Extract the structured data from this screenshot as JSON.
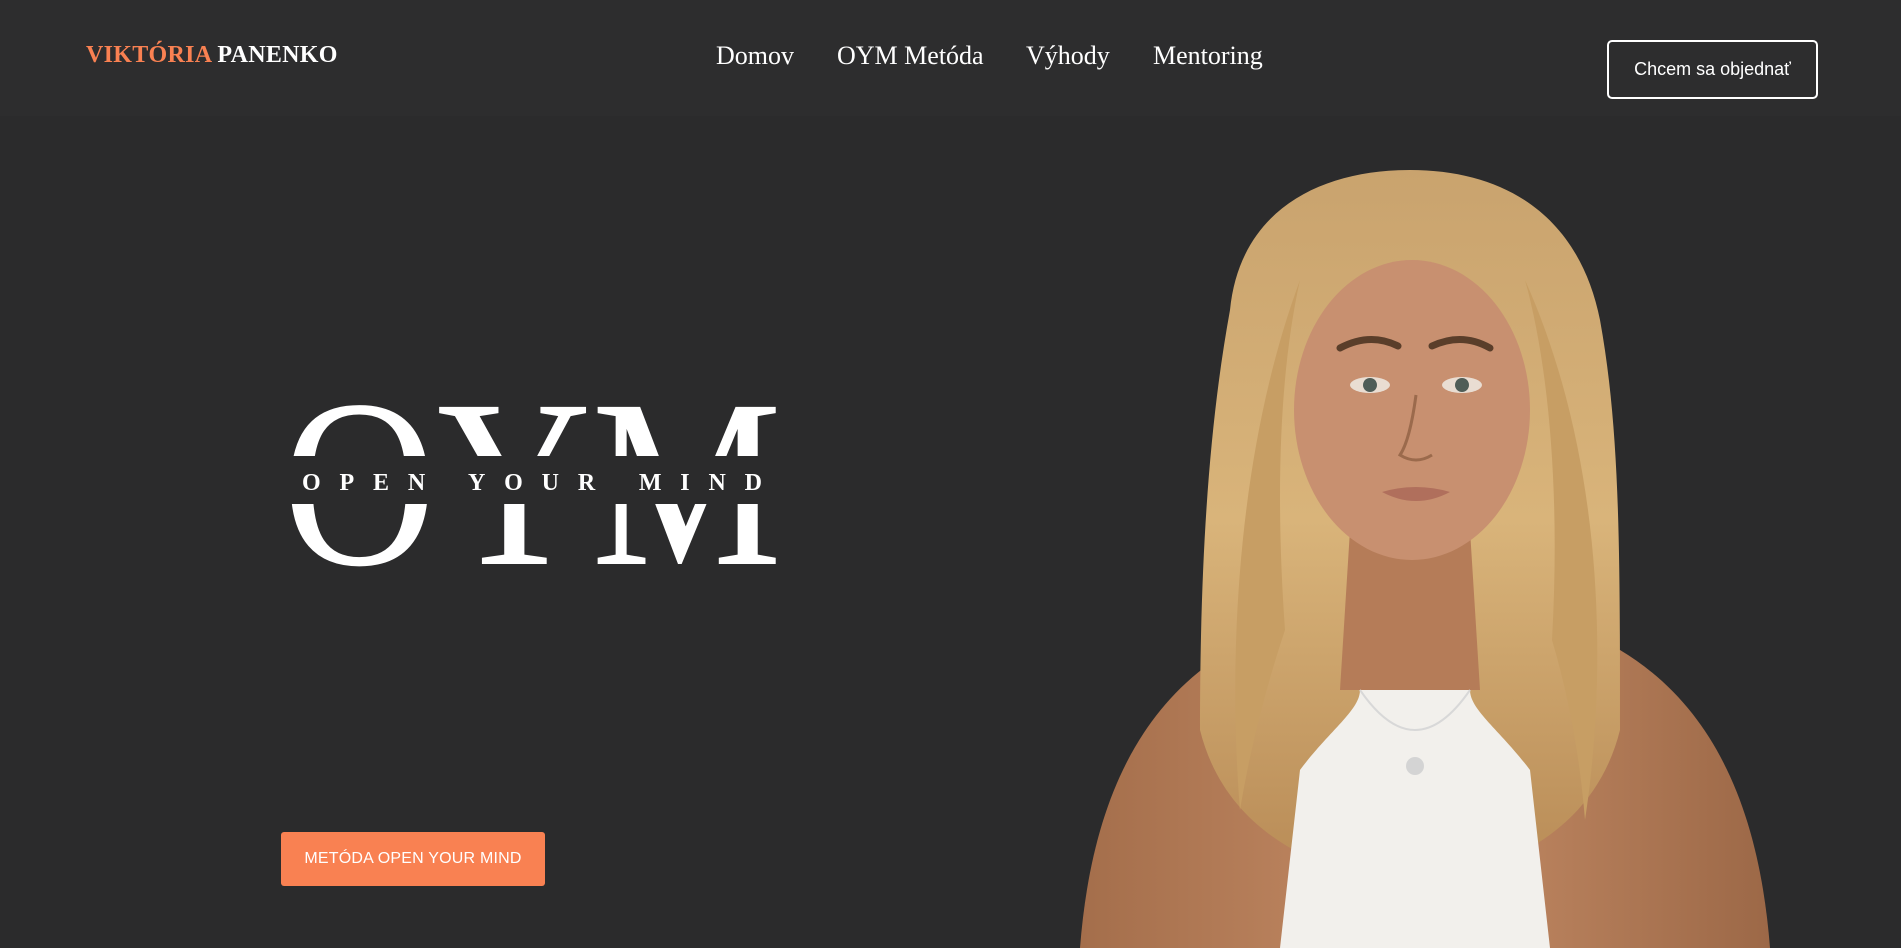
{
  "header": {
    "brand_first": "VIKTÓRIA",
    "brand_last": "PANENKO",
    "nav": {
      "home": "Domov",
      "method": "OYM Metóda",
      "benefits": "Výhody",
      "mentoring": "Mentoring"
    },
    "cta_label": "Chcem sa objednať"
  },
  "hero": {
    "logo_letters": "OYM",
    "logo_tagline": "OPEN YOUR MIND",
    "button_label": "METÓDA OPEN YOUR MIND",
    "portrait_icon": "woman-portrait-photo"
  },
  "colors": {
    "background": "#2b2b2c",
    "accent": "#f98152",
    "text": "#ffffff"
  }
}
